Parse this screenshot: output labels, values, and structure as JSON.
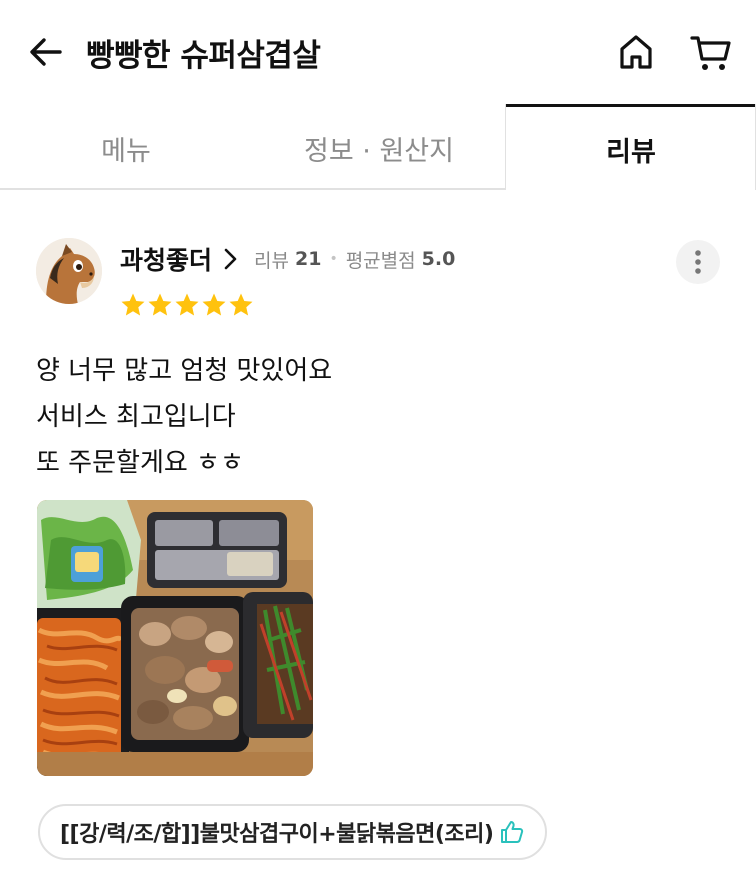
{
  "header": {
    "title": "빵빵한 슈퍼삼겹살",
    "back_icon": "arrow-left-icon",
    "home_icon": "home-icon",
    "cart_icon": "cart-icon"
  },
  "tabs": [
    {
      "label": "메뉴",
      "active": false
    },
    {
      "label": "정보 · 원산지",
      "active": false
    },
    {
      "label": "리뷰",
      "active": true
    }
  ],
  "review": {
    "username": "과청좋더",
    "review_label": "리뷰",
    "review_count": "21",
    "avg_rating_label": "평균별점",
    "avg_rating": "5.0",
    "rating": 5,
    "star_color": "#FFC20E",
    "text_lines": [
      "양 너무 많고 엄청 맛있어요",
      "서비스 최고입니다",
      "또 주문할게요 ㅎㅎ"
    ],
    "ordered_menu": "[[강/력/조/합]]불맛삼겹구이+불닭볶음면(조리)",
    "menu_like_icon": "thumbs-up-icon",
    "accent_color": "#2AC1BC"
  }
}
